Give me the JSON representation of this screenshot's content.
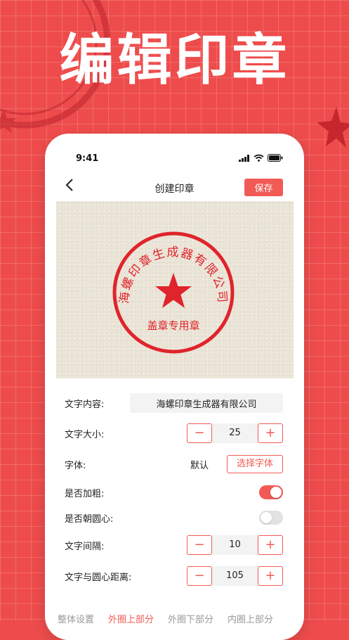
{
  "headline": "编辑印章",
  "status_bar": {
    "time": "9:41"
  },
  "navbar": {
    "title": "创建印章",
    "save_label": "保存"
  },
  "seal": {
    "top_text": "海螺印章生成器有限公司",
    "bottom_text": "盖章专用章",
    "color": "#e0242b"
  },
  "settings": {
    "text_content": {
      "label": "文字内容:",
      "value": "海螺印章生成器有限公司"
    },
    "text_size": {
      "label": "文字大小:",
      "value": "25",
      "minus": "−",
      "plus": "+"
    },
    "font": {
      "label": "字体:",
      "value": "默认",
      "button": "选择字体"
    },
    "bold": {
      "label": "是否加粗:",
      "on": true
    },
    "toward_center": {
      "label": "是否朝圆心:",
      "on": false
    },
    "text_spacing": {
      "label": "文字间隔:",
      "value": "10",
      "minus": "−",
      "plus": "+"
    },
    "text_distance": {
      "label": "文字与圆心距离:",
      "value": "105",
      "minus": "−",
      "plus": "+"
    }
  },
  "tabs": [
    "整体设置",
    "外圈上部分",
    "外圈下部分",
    "内圈上部分"
  ],
  "colors": {
    "accent": "#f25a55",
    "background": "#ee4c4c"
  }
}
